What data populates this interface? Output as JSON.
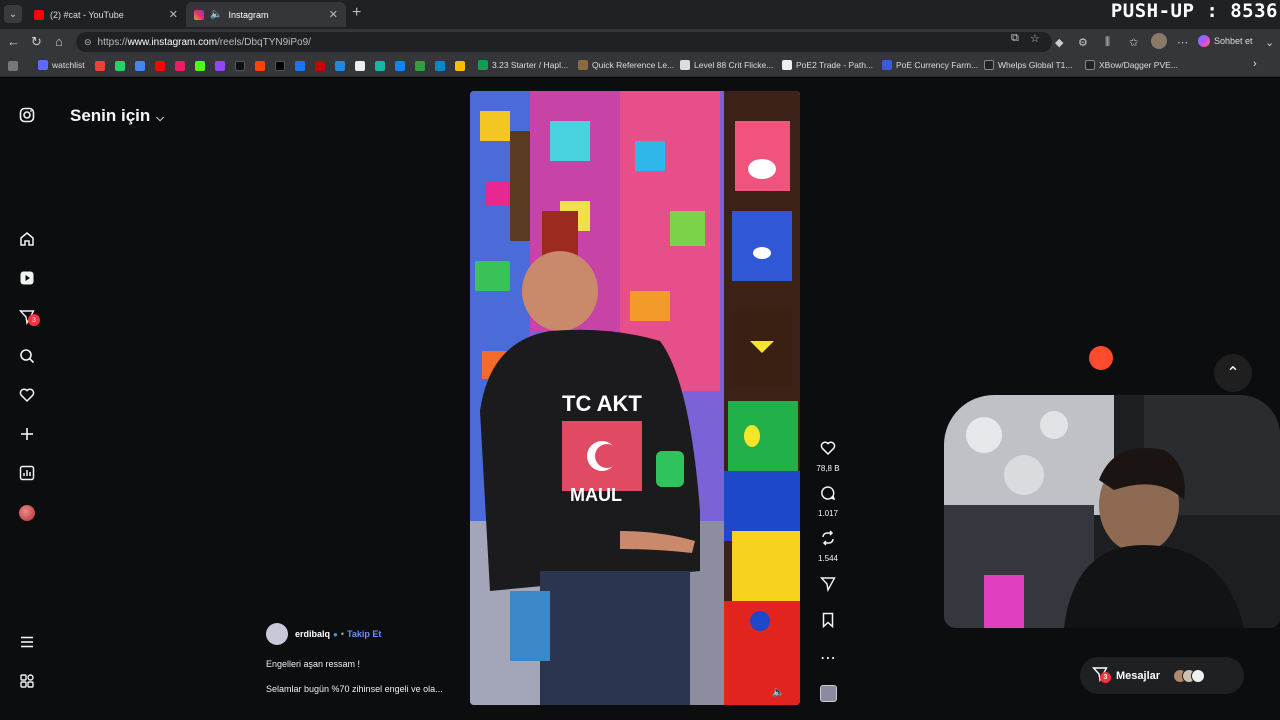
{
  "browser": {
    "tabs": [
      {
        "title": "(2) #cat - YouTube",
        "icon": "youtube-icon",
        "color": "#ff0000"
      },
      {
        "title": "Instagram",
        "icon": "instagram-icon",
        "color": "#e1306c",
        "active": true
      }
    ],
    "url_prefix": "https://",
    "url_domain": "www.instagram.com",
    "url_path": "/reels/DbqTYN9iPo9/",
    "chat_label": "Sohbet et",
    "bookmarks": [
      "watchlist",
      "3.23 Starter / Hapl...",
      "Quick Reference Le...",
      "Level 88 Crit Flicke...",
      "PoE2 Trade - Path...",
      "PoE Currency Farm...",
      "Whelps Global T1...",
      "XBow/Dagger PVE..."
    ]
  },
  "overlay": {
    "pushup": "PUSH-UP : 8536"
  },
  "instagram": {
    "feed_title": "Senin için",
    "nav_badge": "3",
    "reel": {
      "likes": "78,8 B",
      "comments": "1.017",
      "reposts": "1.544",
      "author": "erdibalq",
      "follow": "Takip Et",
      "dot": "•",
      "caption_title": "Engelleri aşan ressam !",
      "caption_body": "Selamlar bugün %70 zihinsel engeli ve ola..."
    },
    "messages": {
      "label": "Mesajlar",
      "badge": "3"
    },
    "colors": {
      "accent": "#3897f0",
      "follow": "#6c8cff",
      "badge": "#ff3040"
    }
  }
}
